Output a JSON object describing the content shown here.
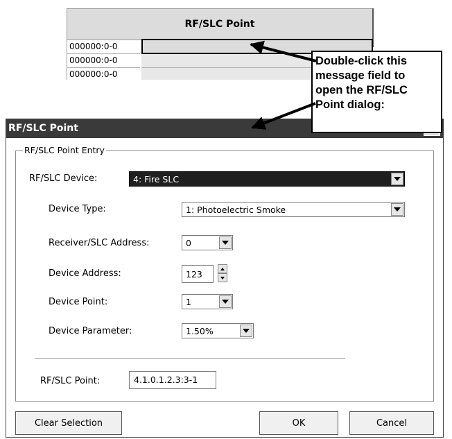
{
  "grid": {
    "header": "RF/SLC Point",
    "rows": [
      "000000:0-0",
      "000000:0-0",
      "000000:0-0"
    ]
  },
  "callout": {
    "lines": [
      "Double-click this",
      "message field to",
      "open the RF/SLC",
      "Point dialog:"
    ]
  },
  "dialog": {
    "title": "RF/SLC Point",
    "close_glyph": "✕",
    "group_label": "RF/SLC Point Entry",
    "fields": {
      "device": {
        "label": "RF/SLC Device:",
        "value": "4: Fire SLC"
      },
      "device_type": {
        "label": "Device Type:",
        "value": "1: Photoelectric Smoke"
      },
      "receiver_address": {
        "label": "Receiver/SLC Address:",
        "value": "0"
      },
      "device_address": {
        "label": "Device Address:",
        "value": "123"
      },
      "device_point": {
        "label": "Device Point:",
        "value": "1"
      },
      "device_parameter": {
        "label": "Device Parameter:",
        "value": "1.50%"
      }
    },
    "point": {
      "label": "RF/SLC Point:",
      "value": "4.1.0.1.2.3:3-1"
    },
    "buttons": {
      "clear": "Clear Selection",
      "ok": "OK",
      "cancel": "Cancel"
    }
  }
}
